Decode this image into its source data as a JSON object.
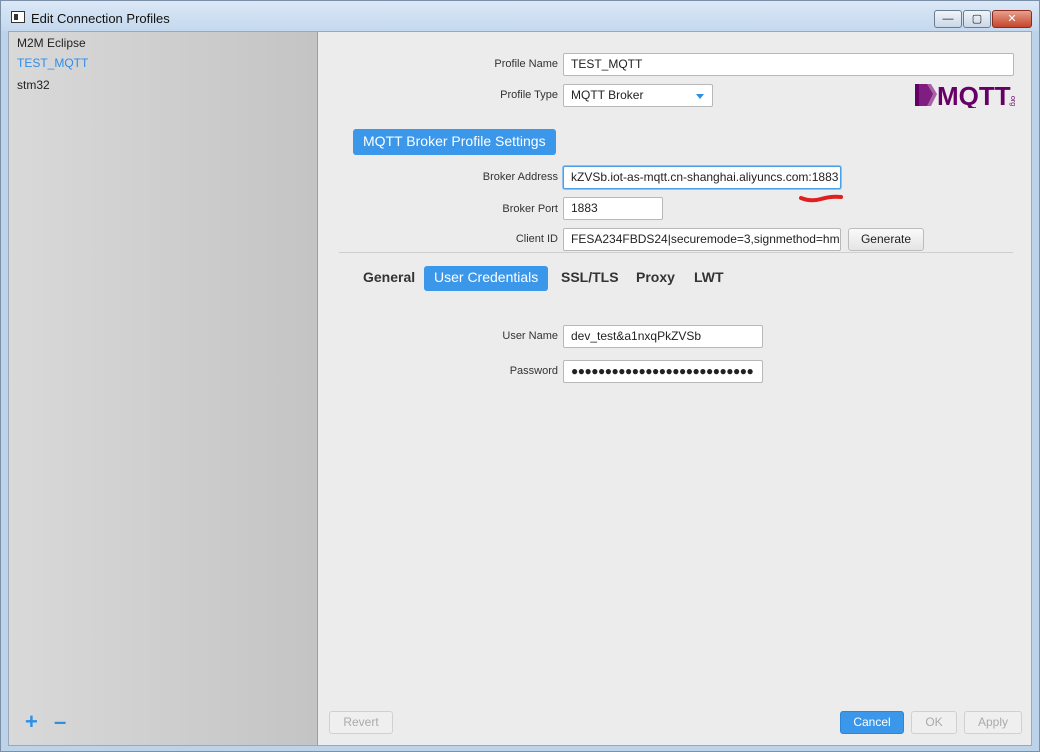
{
  "window": {
    "title": "Edit Connection Profiles"
  },
  "sidebar": {
    "profiles": [
      {
        "label": "M2M Eclipse",
        "active": false
      },
      {
        "label": "TEST_MQTT",
        "active": true
      },
      {
        "label": "stm32",
        "active": false
      }
    ],
    "add_icon": "plus-icon",
    "remove_icon": "minus-icon"
  },
  "form": {
    "profile_name_label": "Profile Name",
    "profile_name_value": "TEST_MQTT",
    "profile_type_label": "Profile Type",
    "profile_type_value": "MQTT Broker",
    "logo_text": "MQTT",
    "logo_suffix": "org"
  },
  "section": {
    "title": "MQTT Broker Profile Settings"
  },
  "broker": {
    "address_label": "Broker Address",
    "address_value": "kZVSb.iot-as-mqtt.cn-shanghai.aliyuncs.com:1883",
    "port_label": "Broker Port",
    "port_value": "1883",
    "client_id_label": "Client ID",
    "client_id_value": "FESA234FBDS24|securemode=3,signmethod=hm",
    "generate_label": "Generate"
  },
  "tabs": [
    {
      "label": "General",
      "active": false
    },
    {
      "label": "User Credentials",
      "active": true
    },
    {
      "label": "SSL/TLS",
      "active": false
    },
    {
      "label": "Proxy",
      "active": false
    },
    {
      "label": "LWT",
      "active": false
    }
  ],
  "credentials": {
    "username_label": "User Name",
    "username_value": "dev_test&a1nxqPkZVSb",
    "password_label": "Password",
    "password_value": "●●●●●●●●●●●●●●●●●●●●●●●●●●●"
  },
  "footer": {
    "revert_label": "Revert",
    "cancel_label": "Cancel",
    "ok_label": "OK",
    "apply_label": "Apply"
  },
  "colors": {
    "accent": "#3b97ea",
    "annotation": "#e0201e"
  }
}
